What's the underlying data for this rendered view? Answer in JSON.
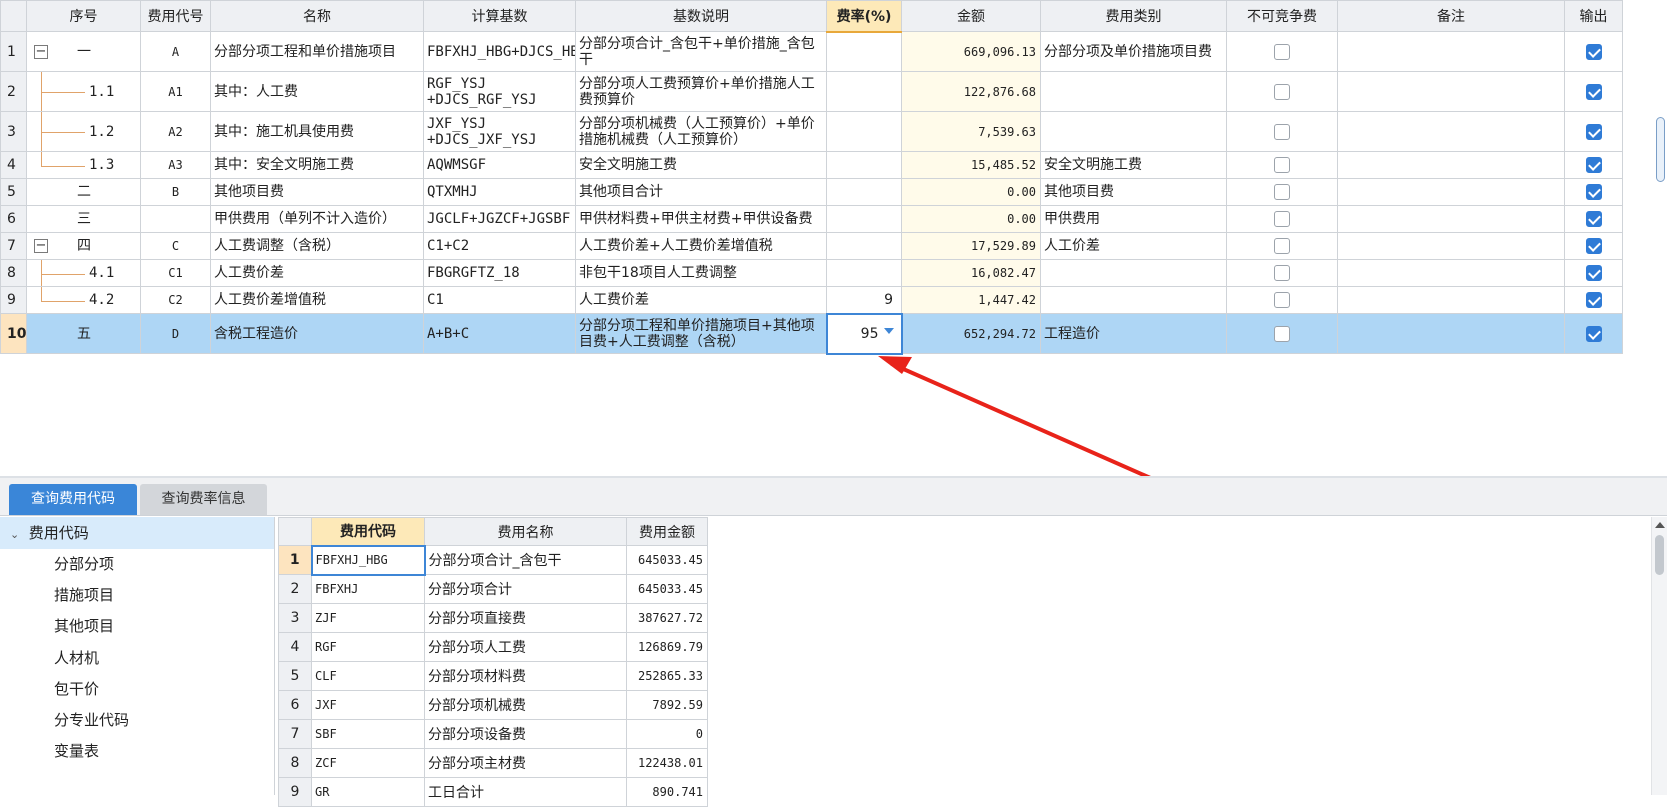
{
  "main_grid": {
    "headers": {
      "seq": "序号",
      "code": "费用代号",
      "name": "名称",
      "base": "计算基数",
      "base_desc": "基数说明",
      "rate": "费率(%)",
      "amount": "金额",
      "category": "费用类别",
      "noncompete": "不可竞争费",
      "note": "备注",
      "output": "输出"
    },
    "rows": [
      {
        "rn": "1",
        "seq": "一",
        "code": "A",
        "name": "分部分项工程和单价措施项目",
        "base": "FBFXHJ_HBG+DJCS_HBG",
        "desc": "分部分项合计_含包干+单价措施_含包干",
        "rate": "",
        "amount": "669,096.13",
        "category": "分部分项及单价措施项目费",
        "noncompete": false,
        "output": true
      },
      {
        "rn": "2",
        "seq": "1.1",
        "code": "A1",
        "name": "其中：人工费",
        "base": "RGF_YSJ +DJCS_RGF_YSJ",
        "desc": "分部分项人工费预算价+单价措施人工费预算价",
        "rate": "",
        "amount": "122,876.68",
        "category": "",
        "noncompete": false,
        "output": true
      },
      {
        "rn": "3",
        "seq": "1.2",
        "code": "A2",
        "name": "其中：施工机具使用费",
        "base": "JXF_YSJ +DJCS_JXF_YSJ",
        "desc": "分部分项机械费（人工预算价）+单价措施机械费（人工预算价）",
        "rate": "",
        "amount": "7,539.63",
        "category": "",
        "noncompete": false,
        "output": true
      },
      {
        "rn": "4",
        "seq": "1.3",
        "code": "A3",
        "name": "其中：安全文明施工费",
        "base": "AQWMSGF",
        "desc": "安全文明施工费",
        "rate": "",
        "amount": "15,485.52",
        "category": "安全文明施工费",
        "noncompete": false,
        "output": true
      },
      {
        "rn": "5",
        "seq": "二",
        "code": "B",
        "name": "其他项目费",
        "base": "QTXMHJ",
        "desc": "其他项目合计",
        "rate": "",
        "amount": "0.00",
        "category": "其他项目费",
        "noncompete": false,
        "output": true
      },
      {
        "rn": "6",
        "seq": "三",
        "code": "",
        "name": "甲供费用（单列不计入造价）",
        "base": "JGCLF+JGZCF+JGSBF",
        "desc": "甲供材料费+甲供主材费+甲供设备费",
        "rate": "",
        "amount": "0.00",
        "category": "甲供费用",
        "noncompete": false,
        "output": true
      },
      {
        "rn": "7",
        "seq": "四",
        "code": "C",
        "name": "人工费调整（含税）",
        "base": "C1+C2",
        "desc": "人工费价差+人工费价差增值税",
        "rate": "",
        "amount": "17,529.89",
        "category": "人工价差",
        "noncompete": false,
        "output": true
      },
      {
        "rn": "8",
        "seq": "4.1",
        "code": "C1",
        "name": "人工费价差",
        "base": "FBGRGFTZ_18",
        "desc": "非包干18项目人工费调整",
        "rate": "",
        "amount": "16,082.47",
        "category": "",
        "noncompete": false,
        "output": true
      },
      {
        "rn": "9",
        "seq": "4.2",
        "code": "C2",
        "name": "人工费价差增值税",
        "base": "C1",
        "desc": "人工费价差",
        "rate": "9",
        "amount": "1,447.42",
        "category": "",
        "noncompete": false,
        "output": true
      },
      {
        "rn": "10",
        "seq": "五",
        "code": "D",
        "name": "含税工程造价",
        "base": "A+B+C",
        "desc": "分部分项工程和单价措施项目+其他项目费+人工费调整（含税）",
        "rate": "95",
        "amount": "652,294.72",
        "category": "工程造价",
        "noncompete": false,
        "output": true
      }
    ]
  },
  "toggles": {
    "row1": "−",
    "row7": "−"
  },
  "tabs": {
    "query_code": "查询费用代码",
    "query_rate": "查询费率信息"
  },
  "tree": {
    "root": "费用代码",
    "items": [
      "分部分项",
      "措施项目",
      "其他项目",
      "人材机",
      "包干价",
      "分专业代码",
      "变量表"
    ]
  },
  "code_grid": {
    "headers": {
      "code": "费用代码",
      "name": "费用名称",
      "amount": "费用金额"
    },
    "rows": [
      {
        "rn": "1",
        "code": "FBFXHJ_HBG",
        "name": "分部分项合计_含包干",
        "amount": "645033.45"
      },
      {
        "rn": "2",
        "code": "FBFXHJ",
        "name": "分部分项合计",
        "amount": "645033.45"
      },
      {
        "rn": "3",
        "code": "ZJF",
        "name": "分部分项直接费",
        "amount": "387627.72"
      },
      {
        "rn": "4",
        "code": "RGF",
        "name": "分部分项人工费",
        "amount": "126869.79"
      },
      {
        "rn": "5",
        "code": "CLF",
        "name": "分部分项材料费",
        "amount": "252865.33"
      },
      {
        "rn": "6",
        "code": "JXF",
        "name": "分部分项机械费",
        "amount": "7892.59"
      },
      {
        "rn": "7",
        "code": "SBF",
        "name": "分部分项设备费",
        "amount": "0"
      },
      {
        "rn": "8",
        "code": "ZCF",
        "name": "分部分项主材费",
        "amount": "122438.01"
      },
      {
        "rn": "9",
        "code": "GR",
        "name": "工日合计",
        "amount": "890.741"
      }
    ]
  },
  "colors": {
    "selected_row": "#aed6f5",
    "accent": "#3a86d8",
    "arrow": "#e8231a",
    "amount_bg": "#fffbea"
  }
}
